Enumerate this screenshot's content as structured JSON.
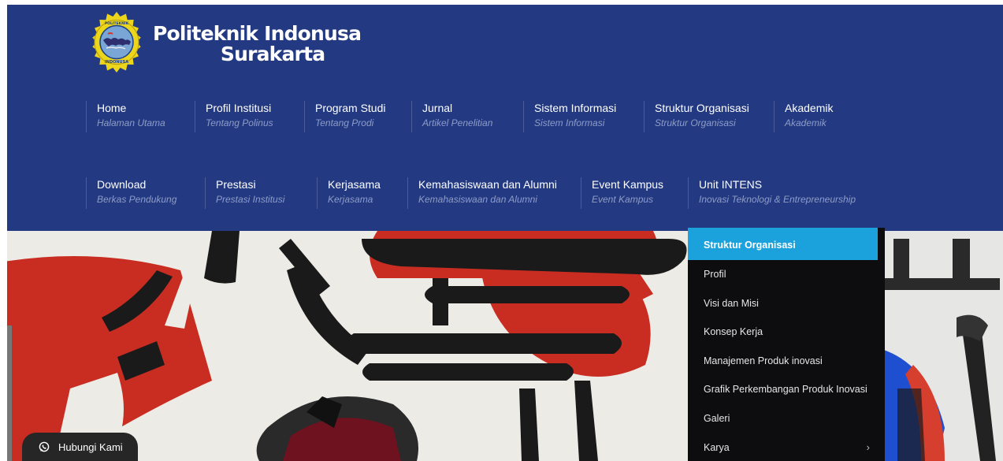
{
  "site": {
    "name_line1": "Politeknik Indonusa",
    "name_line2": "Surakarta",
    "logo_icon": "polinus-logo-emblem"
  },
  "nav": {
    "row1": [
      {
        "label": "Home",
        "sub": "Halaman Utama"
      },
      {
        "label": "Profil Institusi",
        "sub": "Tentang Polinus"
      },
      {
        "label": "Program Studi",
        "sub": "Tentang Prodi"
      },
      {
        "label": "Jurnal",
        "sub": "Artikel Penelitian"
      },
      {
        "label": "Sistem Informasi",
        "sub": "Sistem Informasi"
      },
      {
        "label": "Struktur Organisasi",
        "sub": "Struktur Organisasi"
      },
      {
        "label": "Akademik",
        "sub": "Akademik"
      }
    ],
    "row2": [
      {
        "label": "Download",
        "sub": "Berkas Pendukung"
      },
      {
        "label": "Prestasi",
        "sub": "Prestasi Institusi"
      },
      {
        "label": "Kerjasama",
        "sub": "Kerjasama"
      },
      {
        "label": "Kemahasiswaan dan Alumni",
        "sub": "Kemahasiswaan dan Alumni"
      },
      {
        "label": "Event Kampus",
        "sub": "Event Kampus"
      },
      {
        "label": "Unit INTENS",
        "sub": "Inovasi Teknologi & Entrepreneurship"
      }
    ]
  },
  "dropdown": {
    "items": [
      {
        "label": "Struktur Organisasi"
      },
      {
        "label": "Profil"
      },
      {
        "label": "Visi dan Misi"
      },
      {
        "label": "Konsep Kerja"
      },
      {
        "label": "Manajemen Produk inovasi"
      },
      {
        "label": "Grafik Perkembangan Produk Inovasi"
      },
      {
        "label": "Galeri"
      },
      {
        "label": "Karya"
      }
    ],
    "chevron_icon": "chevron-right-icon",
    "active_index": 0
  },
  "whatsapp": {
    "label": "Hubungi Kami",
    "icon": "whatsapp-icon"
  },
  "colors": {
    "header_bg": "#233a83",
    "dropdown_active": "#1ba1dc",
    "dropdown_bg": "#0d0d0f",
    "nav_sub": "#8e9cc6",
    "wa_button": "#262626"
  }
}
